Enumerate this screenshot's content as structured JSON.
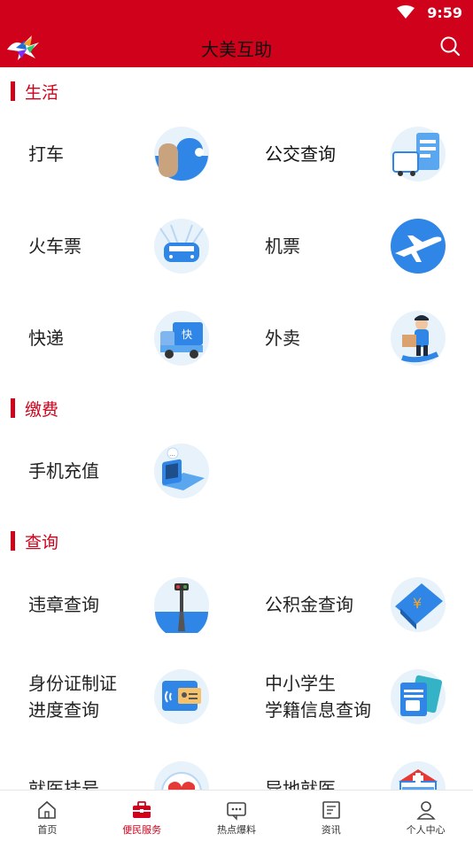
{
  "status_bar": {
    "time": "9:59",
    "wifi_icon": "wifi-icon"
  },
  "app_bar": {
    "title": "大美互助",
    "logo_icon": "app-logo-icon",
    "search_icon": "search-icon"
  },
  "sections": [
    {
      "label": "生活",
      "items": [
        {
          "label": "打车",
          "icon": "taxi-icon"
        },
        {
          "label": "公交查询",
          "icon": "bus-icon"
        },
        {
          "label": "火车票",
          "icon": "train-icon"
        },
        {
          "label": "机票",
          "icon": "airplane-icon"
        },
        {
          "label": "快递",
          "icon": "delivery-truck-icon"
        },
        {
          "label": "外卖",
          "icon": "food-delivery-icon"
        }
      ]
    },
    {
      "label": "缴费",
      "items": [
        {
          "label": "手机充值",
          "icon": "phone-recharge-icon"
        }
      ]
    },
    {
      "label": "查询",
      "items": [
        {
          "label": "违章查询",
          "icon": "traffic-light-icon"
        },
        {
          "label": "公积金查询",
          "icon": "housing-fund-icon"
        },
        {
          "label_line1": "身份证制证",
          "label_line2": "进度查询",
          "icon": "id-card-icon"
        },
        {
          "label_line1": "中小学生",
          "label_line2": "学籍信息查询",
          "icon": "student-record-icon"
        },
        {
          "label": "就医挂号",
          "icon": "hospital-heart-icon"
        },
        {
          "label": "异地就医",
          "icon": "hospital-icon"
        }
      ]
    }
  ],
  "tabs": [
    {
      "label": "首页",
      "icon": "home-icon"
    },
    {
      "label": "便民服务",
      "icon": "toolbox-icon",
      "active": true
    },
    {
      "label": "热点爆料",
      "icon": "chat-icon"
    },
    {
      "label": "资讯",
      "icon": "news-icon"
    },
    {
      "label": "个人中心",
      "icon": "user-icon"
    }
  ],
  "colors": {
    "brand_red": "#d0021b",
    "icon_blue": "#2f86e6"
  }
}
